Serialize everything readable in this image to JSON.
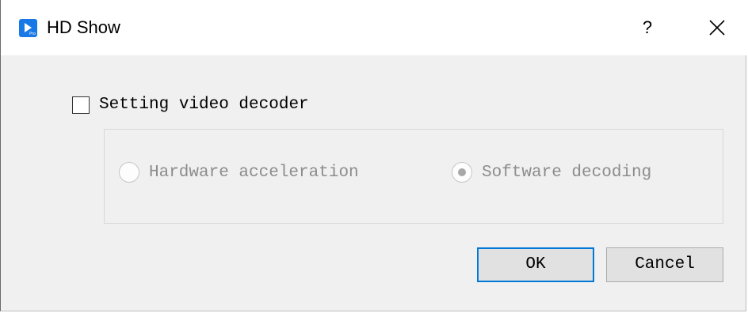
{
  "window": {
    "title": "HD Show",
    "app_icon": "hd-show-pro-icon",
    "help_label": "?",
    "close_icon": "close-icon"
  },
  "settings": {
    "checkbox_label": "Setting video decoder",
    "checkbox_checked": false,
    "options": [
      {
        "label": "Hardware acceleration",
        "selected": false,
        "enabled": false
      },
      {
        "label": "Software decoding",
        "selected": true,
        "enabled": false
      }
    ]
  },
  "buttons": {
    "ok_label": "OK",
    "cancel_label": "Cancel"
  },
  "colors": {
    "accent": "#0078d7",
    "app_icon": "#1778e6",
    "dialog_background": "#f0f0f0",
    "disabled_text": "#8c8c8c"
  }
}
